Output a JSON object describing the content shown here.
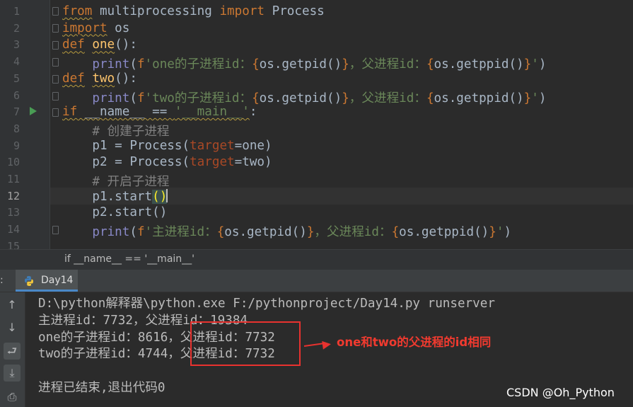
{
  "editor": {
    "lines": [
      {
        "num": "1",
        "tokens": [
          {
            "t": "from",
            "c": "kw warn"
          },
          {
            "t": " multiprocessing ",
            "c": ""
          },
          {
            "t": "import",
            "c": "kw"
          },
          {
            "t": " Process",
            "c": ""
          }
        ]
      },
      {
        "num": "2",
        "tokens": [
          {
            "t": "import",
            "c": "kw warn"
          },
          {
            "t": " os",
            "c": ""
          }
        ]
      },
      {
        "num": "3",
        "tokens": [
          {
            "t": "def",
            "c": "kw warn"
          },
          {
            "t": " ",
            "c": ""
          },
          {
            "t": "one",
            "c": "fn warn"
          },
          {
            "t": "():",
            "c": ""
          }
        ]
      },
      {
        "num": "4",
        "tokens": [
          {
            "t": "    ",
            "c": ""
          },
          {
            "t": "print",
            "c": "bi"
          },
          {
            "t": "(",
            "c": ""
          },
          {
            "t": "f",
            "c": "kw"
          },
          {
            "t": "'one的子进程id：",
            "c": "str"
          },
          {
            "t": "{",
            "c": "kw"
          },
          {
            "t": "os.getpid()",
            "c": ""
          },
          {
            "t": "}",
            "c": "kw"
          },
          {
            "t": "，父进程id：",
            "c": "str"
          },
          {
            "t": "{",
            "c": "kw"
          },
          {
            "t": "os.getppid()",
            "c": ""
          },
          {
            "t": "}",
            "c": "kw"
          },
          {
            "t": "'",
            "c": "str"
          },
          {
            "t": ")",
            "c": ""
          }
        ]
      },
      {
        "num": "5",
        "tokens": [
          {
            "t": "def",
            "c": "kw warn"
          },
          {
            "t": " ",
            "c": ""
          },
          {
            "t": "two",
            "c": "fn warn"
          },
          {
            "t": "():",
            "c": ""
          }
        ]
      },
      {
        "num": "6",
        "tokens": [
          {
            "t": "    ",
            "c": ""
          },
          {
            "t": "print",
            "c": "bi"
          },
          {
            "t": "(",
            "c": ""
          },
          {
            "t": "f",
            "c": "kw"
          },
          {
            "t": "'two的子进程id：",
            "c": "str"
          },
          {
            "t": "{",
            "c": "kw"
          },
          {
            "t": "os.getpid()",
            "c": ""
          },
          {
            "t": "}",
            "c": "kw"
          },
          {
            "t": "，父进程id：",
            "c": "str"
          },
          {
            "t": "{",
            "c": "kw"
          },
          {
            "t": "os.getppid()",
            "c": ""
          },
          {
            "t": "}",
            "c": "kw"
          },
          {
            "t": "'",
            "c": "str"
          },
          {
            "t": ")",
            "c": ""
          }
        ]
      },
      {
        "num": "7",
        "tokens": [
          {
            "t": "if",
            "c": "kw warn"
          },
          {
            "t": " __name__ == ",
            "c": "warn"
          },
          {
            "t": "'__main__'",
            "c": "str warn"
          },
          {
            "t": ":",
            "c": ""
          }
        ]
      },
      {
        "num": "8",
        "tokens": [
          {
            "t": "    # 创建子进程",
            "c": "cm"
          }
        ]
      },
      {
        "num": "9",
        "tokens": [
          {
            "t": "    p1 = Process(",
            "c": ""
          },
          {
            "t": "target",
            "c": "prm"
          },
          {
            "t": "=one)",
            "c": ""
          }
        ]
      },
      {
        "num": "10",
        "tokens": [
          {
            "t": "    p2 = Process(",
            "c": ""
          },
          {
            "t": "target",
            "c": "prm"
          },
          {
            "t": "=two)",
            "c": ""
          }
        ]
      },
      {
        "num": "11",
        "tokens": [
          {
            "t": "    # 开启子进程",
            "c": "cm"
          }
        ]
      },
      {
        "num": "12",
        "tokens": [
          {
            "t": "    p1.start",
            "c": ""
          },
          {
            "t": "(",
            "c": "bracket-hl"
          },
          {
            "t": ")",
            "c": "bracket-hl caret-after"
          }
        ]
      },
      {
        "num": "13",
        "tokens": [
          {
            "t": "    p2.start()",
            "c": ""
          }
        ]
      },
      {
        "num": "14",
        "tokens": [
          {
            "t": "    ",
            "c": ""
          },
          {
            "t": "print",
            "c": "bi"
          },
          {
            "t": "(",
            "c": ""
          },
          {
            "t": "f",
            "c": "kw"
          },
          {
            "t": "'主进程id：",
            "c": "str"
          },
          {
            "t": "{",
            "c": "kw"
          },
          {
            "t": "os.getpid()",
            "c": ""
          },
          {
            "t": "}",
            "c": "kw"
          },
          {
            "t": "，父进程id：",
            "c": "str"
          },
          {
            "t": "{",
            "c": "kw"
          },
          {
            "t": "os.getppid()",
            "c": ""
          },
          {
            "t": "}",
            "c": "kw"
          },
          {
            "t": "'",
            "c": "str"
          },
          {
            "t": ")",
            "c": ""
          }
        ]
      },
      {
        "num": "15",
        "tokens": []
      }
    ],
    "active_line": "12"
  },
  "breadcrumb": {
    "text": "if __name__ == '__main__'"
  },
  "run_panel": {
    "label": ":",
    "tab_name": "Day14",
    "console_lines": [
      "D:\\python解释器\\python.exe F:/pythonproject/Day14.py runserver",
      "主进程id：7732，父进程id：19384",
      "one的子进程id：8616，父进程id：7732",
      "two的子进程id：4744，父进程id：7732",
      "",
      "进程已结束,退出代码0"
    ]
  },
  "annotation": {
    "text": "one和two的父进程的id相同",
    "color": "#f03a2f"
  },
  "watermark": {
    "text": "CSDN @Oh_Python"
  },
  "toolbar_icons": [
    "arrow-up-icon",
    "arrow-down-icon",
    "soft-wrap-icon",
    "scroll-to-end-icon",
    "print-icon"
  ]
}
